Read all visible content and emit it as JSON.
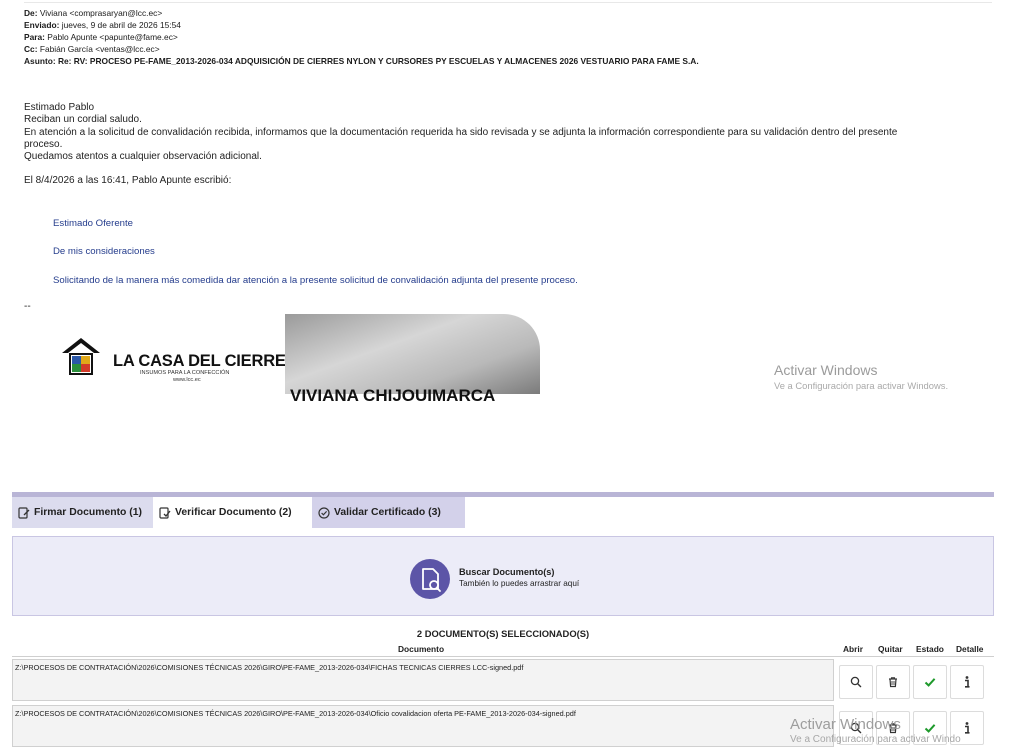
{
  "email": {
    "headers": [
      {
        "label": "De:",
        "value": " Viviana <comprasaryan@lcc.ec>"
      },
      {
        "label": "Enviado:",
        "value": " jueves, 9 de abril de 2026 15:54"
      },
      {
        "label": "Para:",
        "value": " Pablo Apunte <papunte@fame.ec>"
      },
      {
        "label": "Cc:",
        "value": " Fabián García <ventas@lcc.ec>"
      },
      {
        "label": "Asunto:",
        "value": " Re: RV: PROCESO PE-FAME_2013-2026-034 ADQUISICIÓN DE CIERRES NYLON Y CURSORES PY ESCUELAS Y ALMACENES 2026 VESTUARIO PARA FAME S.A."
      }
    ],
    "body_lines": [
      "Estimado Pablo",
      "Reciban un cordial saludo.",
      "En atención a la solicitud de convalidación recibida, informamos que la documentación requerida ha sido revisada y se adjunta la información correspondiente para su validación dentro del presente",
      "proceso.",
      "Quedamos atentos a cualquier observación adicional."
    ],
    "quote_header": "El 8/4/2026 a las 16:41, Pablo Apunte escribió:",
    "quoted_lines": [
      "Estimado Oferente",
      "De mis consideraciones",
      "Solicitando de la manera más comedida dar atención a la presente solicitud de convalidación adjunta del presente proceso."
    ],
    "separator": "--",
    "signature": {
      "brand": "LA CASA DEL CIERRE",
      "tagline": "INSUMOS PARA LA CONFECCIÓN",
      "url": "www.lcc.ec",
      "name": "VIVIANA CHIJOUIMARCA"
    }
  },
  "watermark": {
    "title": "Activar Windows",
    "subtitle": "Ve a Configuración para activar Windows.",
    "subtitle_cut": "Ve a Configuración para activar Windo"
  },
  "app": {
    "tabs": [
      {
        "label": "Firmar Documento (1)"
      },
      {
        "label": "Verificar Documento (2)"
      },
      {
        "label": "Validar Certificado (3)"
      }
    ],
    "dropzone": {
      "title": "Buscar Documento(s)",
      "subtitle": "También lo puedes arrastrar aquí"
    },
    "selected_count": "2 DOCUMENTO(S) SELECCIONADO(S)",
    "columns": {
      "document": "Documento",
      "open": "Abrir",
      "remove": "Quitar",
      "status": "Estado",
      "detail": "Detalle"
    },
    "rows": [
      {
        "path": "Z:\\PROCESOS DE CONTRATACIÓN\\2026\\COMISIONES TÉCNICAS 2026\\GIRO\\PE-FAME_2013-2026-034\\FICHAS TECNICAS CIERRES LCC-signed.pdf"
      },
      {
        "path": "Z:\\PROCESOS DE CONTRATACIÓN\\2026\\COMISIONES TÉCNICAS 2026\\GIRO\\PE-FAME_2013-2026-034\\Oficio covalidacion oferta PE-FAME_2013-2026-034-signed.pdf"
      }
    ],
    "colors": {
      "accent": "#5c55a7",
      "check": "#1f9a2c",
      "tab_bg": "#d3d1ea",
      "drop_bg": "#ececf8"
    }
  }
}
